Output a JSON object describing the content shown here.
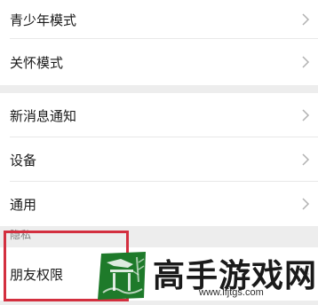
{
  "settings": {
    "group1": [
      {
        "label": "青少年模式",
        "icon": "chevron-right-icon"
      },
      {
        "label": "关怀模式",
        "icon": "chevron-right-icon"
      }
    ],
    "group2": [
      {
        "label": "新消息通知",
        "icon": "chevron-right-icon"
      },
      {
        "label": "设备",
        "icon": "chevron-right-icon"
      },
      {
        "label": "通用",
        "icon": "chevron-right-icon"
      }
    ],
    "privacy_section": {
      "header": "隐私",
      "items": [
        {
          "label": "朋友权限",
          "icon": "chevron-right-icon"
        }
      ]
    }
  },
  "annotation": {
    "highlight_color": "#d32f3f"
  },
  "watermark": {
    "title": "高手游戏网",
    "url": "www.lfjtgs.com",
    "logo_color": "#1e7a2a"
  },
  "colors": {
    "background": "#ededed",
    "row_background": "#ffffff",
    "chevron": "#b2b2b2",
    "header_text": "#7f7f7f"
  }
}
